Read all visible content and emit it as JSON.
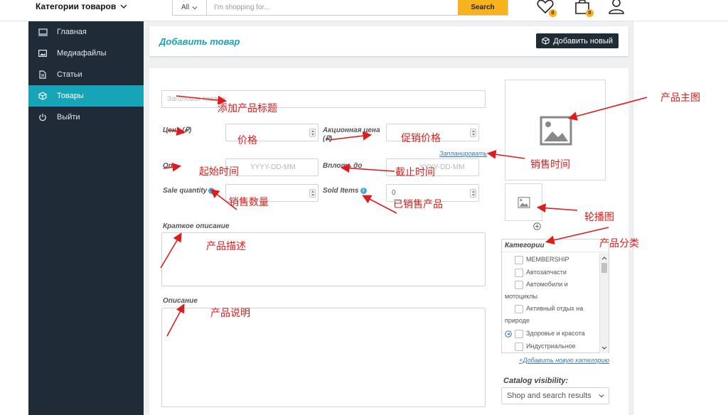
{
  "topbar": {
    "category_menu": "Категории товаров",
    "search_category": "All",
    "search_placeholder": "I'm shopping for...",
    "search_button": "Search",
    "wishlist_count": "0",
    "cart_count": "0"
  },
  "sidebar": {
    "items": [
      {
        "label": "Главная",
        "icon": "monitor-icon"
      },
      {
        "label": "Медиафайлы",
        "icon": "image-icon"
      },
      {
        "label": "Статьи",
        "icon": "document-icon"
      },
      {
        "label": "Товары",
        "icon": "box-icon",
        "active": true
      },
      {
        "label": "Выйти",
        "icon": "power-icon"
      }
    ]
  },
  "header": {
    "title": "Добавить товар",
    "add_new": "Добавить новый"
  },
  "form": {
    "title_placeholder": "Заголовок товара",
    "price_label": "Цена (₽)",
    "sale_price_label": "Акционная цена (₽)",
    "schedule_link": "Запланировать",
    "from_label": "От",
    "from_placeholder": "YYYY-DD-MM",
    "to_label": "Вплоть до",
    "to_placeholder": "YYYY-DD-MM",
    "sale_quantity_label": "Sale quantity",
    "sold_items_label": "Sold Items",
    "sold_items_value": "0",
    "short_desc_label": "Краткое описание",
    "desc_label": "Описание"
  },
  "categories": {
    "title": "Категории",
    "items": [
      "MEMBERSHIP",
      "Автозапчасти",
      "Автомобили и мотоциклы",
      "Активный отдых на природе",
      "Здоровье и красота",
      "Индустриальное"
    ],
    "add_link": "+Добавить новую категорию"
  },
  "visibility": {
    "label": "Catalog visibility:",
    "selected": "Shop and search results"
  },
  "annotations": {
    "title": "添加产品标题",
    "price": "价格",
    "sale_price": "促销价格",
    "start_time": "起始时间",
    "end_time": "截止时间",
    "sale_quantity": "销售数量",
    "sold_items": "已销售产品",
    "short_desc": "产品描述",
    "desc": "产品说明",
    "main_image": "产品主图",
    "sale_time": "销售时间",
    "carousel": "轮播图",
    "category": "产品分类"
  },
  "colors": {
    "accent": "#17a3b8",
    "sidebar": "#1f2b36",
    "search_button": "#f8b21c",
    "annotation": "#e01b1b"
  }
}
